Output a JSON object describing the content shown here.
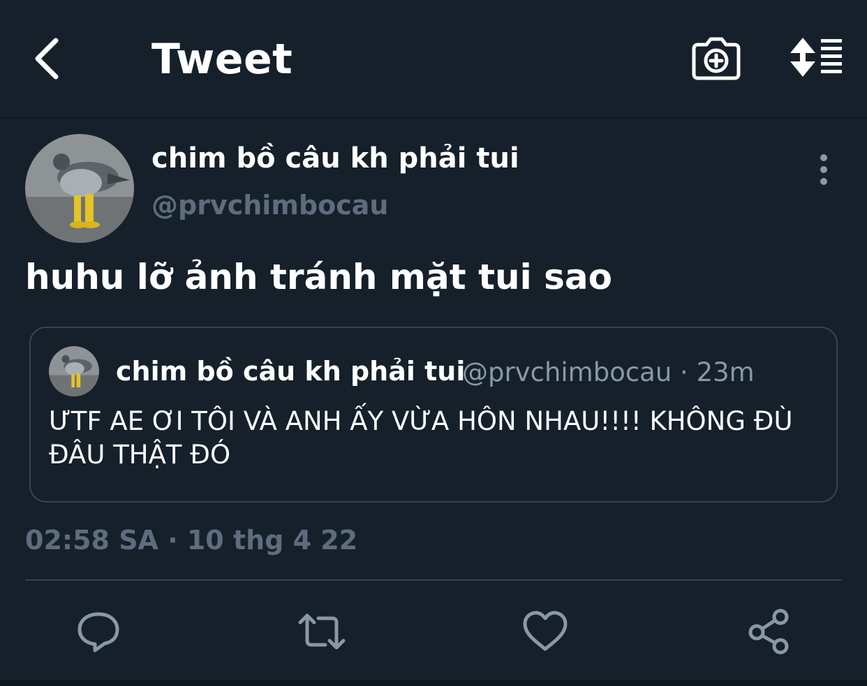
{
  "header": {
    "title": "Tweet",
    "back_icon": "chevron-left-icon",
    "camera_icon": "camera-plus-icon",
    "sort_icon": "sort-list-icon"
  },
  "tweet": {
    "author": {
      "display_name": "chim bồ câu kh phải tui",
      "handle": "@prvchimbocau",
      "avatar": "pigeon-in-yellow-boots"
    },
    "text": "huhu lỡ ảnh tránh mặt tui sao",
    "quote": {
      "display_name": "chim bồ câu kh phải tui",
      "handle_time": "@prvchimbocau · 23m",
      "text": "ƯTF AE ƠI TÔI VÀ ANH ẤY VỪA HÔN NHAU!!!! KHÔNG ĐÙ ĐÂU THẬT ĐÓ"
    },
    "timestamp": "02:58 SA · 10 thg 4 22"
  },
  "actions": [
    "reply-icon",
    "retweet-icon",
    "like-icon",
    "share-icon"
  ],
  "colors": {
    "background": "#15202b",
    "secondary_text": "#5d6d7e",
    "border": "#38444d",
    "icon": "#8899a6"
  }
}
